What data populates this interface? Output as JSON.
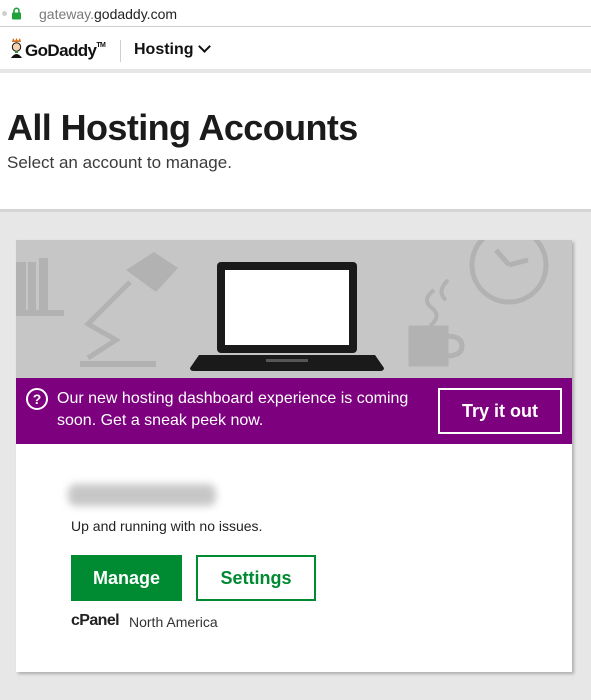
{
  "browser": {
    "url_prefix": "gateway.",
    "url_domain": "godaddy.com"
  },
  "nav": {
    "brand": "GoDaddy",
    "trademark": "TM",
    "menu_label": "Hosting"
  },
  "page": {
    "title": "All Hosting Accounts",
    "subtitle": "Select an account to manage."
  },
  "promo": {
    "icon": "?",
    "message": "Our new hosting dashboard experience is coming soon. Get a sneak peek now.",
    "button_label": "Try it out"
  },
  "account": {
    "status": "Up and running with no issues.",
    "manage_label": "Manage",
    "settings_label": "Settings",
    "platform": "cPanel",
    "region": "North America"
  },
  "colors": {
    "brand_green": "#008a32",
    "promo_purple": "#7d017f",
    "hero_gray": "#c6c6c6",
    "page_gray": "#e7e7e7"
  }
}
